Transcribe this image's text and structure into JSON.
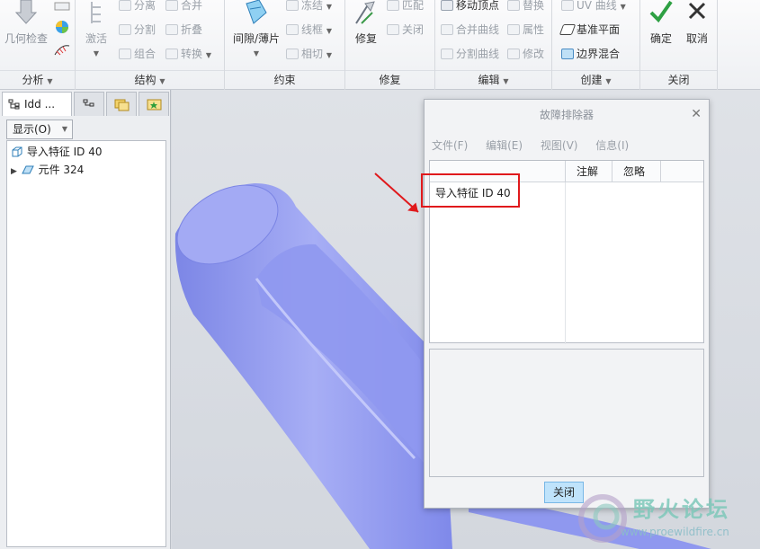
{
  "ribbon": {
    "groups": {
      "analysis": "分析",
      "structure": "结构",
      "constraint": "约束",
      "repair": "修复",
      "edit": "编辑",
      "create": "创建",
      "close": "关闭"
    },
    "tools": {
      "geometry_check": "几何检查",
      "activate": "激活",
      "separate": "分离",
      "merge_top": "合并",
      "split": "分割",
      "fold": "折叠",
      "group": "组合",
      "convert": "转换",
      "gap_sheet": "间隙/薄片",
      "freeze": "冻结",
      "wireframe": "线框",
      "tangent": "相切",
      "match": "匹配",
      "close_small": "关闭",
      "repair_tool": "修复",
      "move_vertex": "移动顶点",
      "replace": "替换",
      "merge_curve": "合并曲线",
      "properties": "属性",
      "split_curve": "分割曲线",
      "modify": "修改",
      "uv_curve": "UV 曲线",
      "datum_plane": "基准平面",
      "boundary_blend": "边界混合",
      "ok": "确定",
      "cancel": "取消"
    }
  },
  "left_panel": {
    "tab_label": "Idd ...",
    "show_label": "显示(O)",
    "tree": [
      {
        "label": "导入特征 ID 40"
      },
      {
        "label": "元件 324"
      }
    ]
  },
  "dialog": {
    "title": "故障排除器",
    "menu": [
      "文件(F)",
      "编辑(E)",
      "视图(V)",
      "信息(I)"
    ],
    "columns": [
      "注解",
      "忽略"
    ],
    "row_label": "导入特征 ID 40",
    "close_label": "关闭"
  },
  "watermark": {
    "title": "野火论坛",
    "url": "www.proewildfire.cn"
  },
  "colors": {
    "accent_red": "#e0191c",
    "model_blue": "#8f98ef",
    "button_blue": "#bfe3fb"
  }
}
